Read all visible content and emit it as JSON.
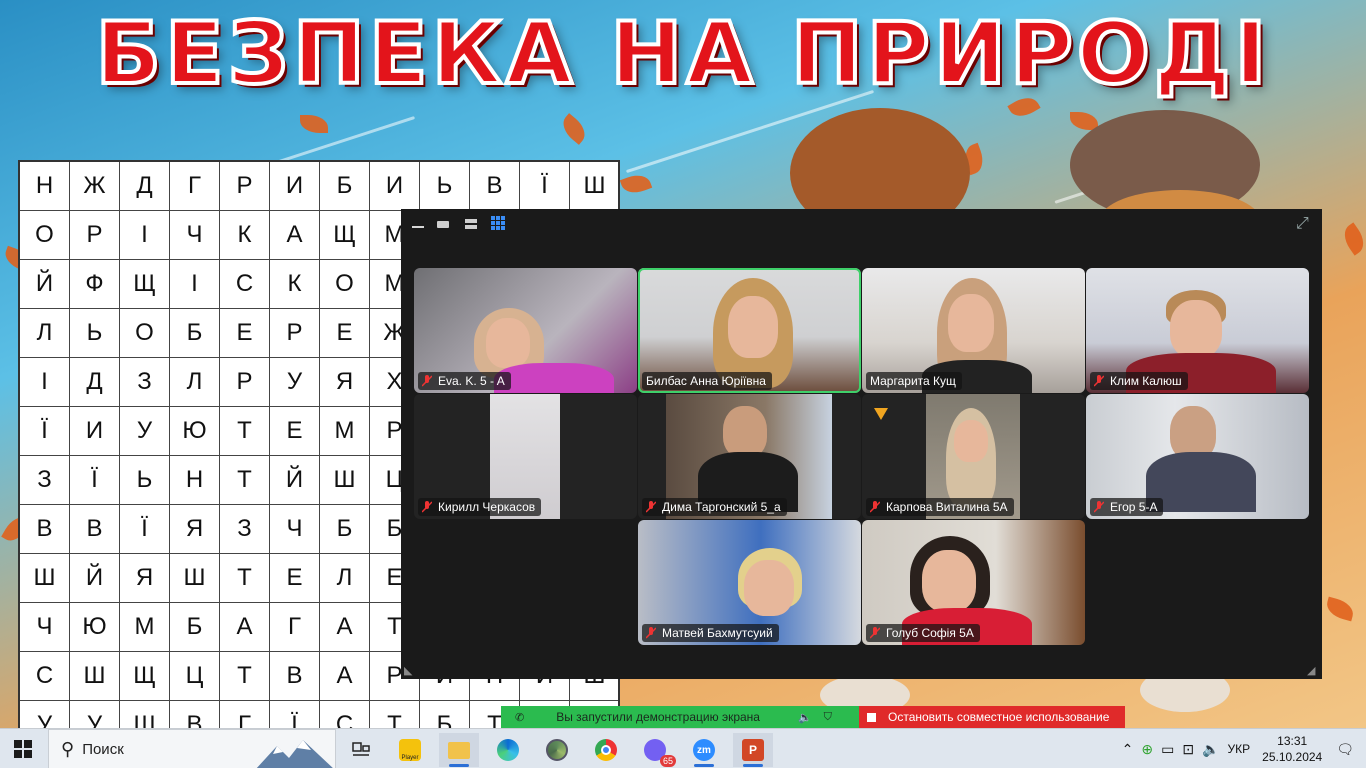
{
  "slide": {
    "banner": "БЕЗПЕКА НА ПРИРОДІ",
    "grid": [
      [
        "Н",
        "Ж",
        "Д",
        "Г",
        "Р",
        "И",
        "Б",
        "И",
        "Ь",
        "В",
        "Ї",
        "Ш"
      ],
      [
        "О",
        "Р",
        "І",
        "Ч",
        "К",
        "А",
        "Щ",
        "М",
        "",
        "",
        "",
        ""
      ],
      [
        "Й",
        "Ф",
        "Щ",
        "І",
        "С",
        "К",
        "О",
        "М",
        "",
        "",
        "",
        ""
      ],
      [
        "Л",
        "Ь",
        "О",
        "Б",
        "Е",
        "Р",
        "Е",
        "Ж",
        "",
        "",
        "",
        ""
      ],
      [
        "І",
        "Д",
        "З",
        "Л",
        "Р",
        "У",
        "Я",
        "Х",
        "",
        "",
        "",
        ""
      ],
      [
        "Ї",
        "И",
        "У",
        "Ю",
        "Т",
        "Е",
        "М",
        "Р",
        "",
        "",
        "",
        ""
      ],
      [
        "З",
        "Ї",
        "Ь",
        "Н",
        "Т",
        "Й",
        "Ш",
        "Ц",
        "",
        "",
        "",
        ""
      ],
      [
        "В",
        "В",
        "Ї",
        "Я",
        "З",
        "Ч",
        "Б",
        "Б",
        "",
        "",
        "",
        ""
      ],
      [
        "Ш",
        "Й",
        "Я",
        "Ш",
        "Т",
        "Е",
        "Л",
        "Е",
        "",
        "",
        "",
        ""
      ],
      [
        "Ч",
        "Ю",
        "М",
        "Б",
        "А",
        "Г",
        "А",
        "Т",
        "",
        "",
        "",
        ""
      ],
      [
        "С",
        "Ш",
        "Щ",
        "Ц",
        "Т",
        "В",
        "А",
        "Р",
        "И",
        "Н",
        "И",
        "Ш"
      ],
      [
        "У",
        "У",
        "Ш",
        "В",
        "Г",
        "Ї",
        "С",
        "Т",
        "Б",
        "Т",
        "",
        ""
      ]
    ]
  },
  "zoom": {
    "view_buttons": [
      "minimize-icon",
      "speaker-view-icon",
      "stacked-view-icon",
      "gallery-view-icon"
    ],
    "participants": [
      {
        "name": "Eva. K. 5 - A",
        "muted": true,
        "active": false
      },
      {
        "name": "Билбас Анна Юріївна",
        "muted": false,
        "active": true
      },
      {
        "name": "Маргарита Кущ",
        "muted": false,
        "active": false
      },
      {
        "name": "Клим Калюш",
        "muted": true,
        "active": false
      },
      {
        "name": "Кирилл Черкасов",
        "muted": true,
        "active": false
      },
      {
        "name": "Дима Таргонский 5_а",
        "muted": true,
        "active": false
      },
      {
        "name": "Карпова Виталина 5А",
        "muted": true,
        "active": false
      },
      {
        "name": "Егор 5-А",
        "muted": true,
        "active": false
      },
      {
        "name": "Матвей Бахмутсуий",
        "muted": true,
        "active": false
      },
      {
        "name": "Голуб Софія 5А",
        "muted": true,
        "active": false
      }
    ]
  },
  "share": {
    "status": "Вы запустили демонстрацию экрана",
    "stop_label": "Остановить совместное использование"
  },
  "taskbar": {
    "search_label": "Поиск",
    "apps": [
      "task-view-icon",
      "player-app-icon",
      "file-explorer-icon",
      "edge-icon",
      "chrome-alt-icon",
      "chrome-icon",
      "viber-icon",
      "zoom-icon",
      "powerpoint-icon"
    ],
    "viber_badge": "65",
    "zoom_label": "zm",
    "player_label": "Player",
    "lang": "УКР",
    "time": "13:31",
    "date": "25.10.2024"
  },
  "colors": {
    "banner": "#e3141b",
    "active_speaker": "#3fd06a",
    "share_green": "#2bbb4f",
    "share_red": "#e02a2a"
  }
}
